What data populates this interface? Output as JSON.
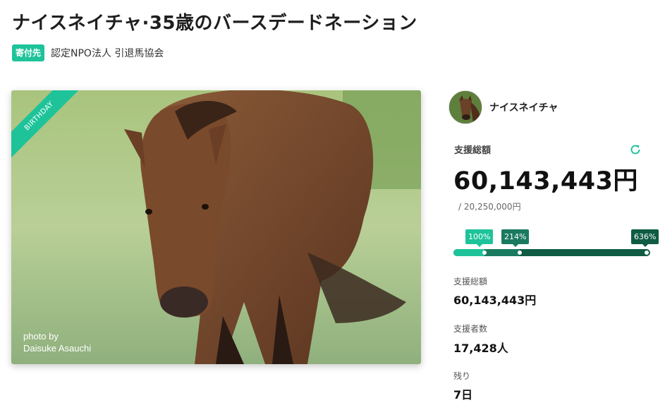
{
  "page_title": "ナイスネイチャ·35歳のバースデードネーション",
  "organization": {
    "badge": "寄付先",
    "name": "認定NPO法人 引退馬協会"
  },
  "photo": {
    "ribbon": "BIRTHDAY",
    "credit_line1": "photo by",
    "credit_line2": "Daisuke Asauchi"
  },
  "horse": {
    "name": "ナイスネイチャ"
  },
  "funding": {
    "total_label": "支援総額",
    "total_amount": "60,143,443円",
    "goal": "/ 20,250,000円",
    "milestones": [
      {
        "label": "100%",
        "value": 100
      },
      {
        "label": "214%",
        "value": 214
      },
      {
        "label": "636%",
        "value": 636
      }
    ],
    "stats": [
      {
        "label": "支援総額",
        "value": "60,143,443円"
      },
      {
        "label": "支援者数",
        "value": "17,428人"
      },
      {
        "label": "残り",
        "value": "7日"
      }
    ]
  },
  "colors": {
    "accent": "#1ec39a",
    "mid_green": "#1a7a5f",
    "dark_green": "#0f5b44"
  }
}
